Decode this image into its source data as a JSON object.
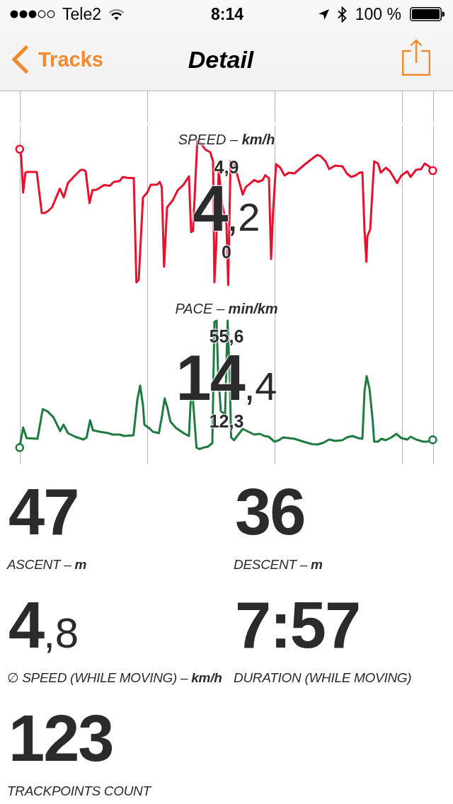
{
  "status_bar": {
    "carrier": "Tele2",
    "time": "8:14",
    "battery": "100 %"
  },
  "nav_bar": {
    "back": "Tracks",
    "title": "Detail"
  },
  "charts": [
    {
      "kind": "speed",
      "title": "SPEED – **km/h**",
      "color": "#e8112d",
      "max": "4,9",
      "average": {
        "whole": "4",
        "fraction": ",2"
      },
      "min": "0"
    },
    {
      "kind": "pace",
      "title": "PACE – **min/km**",
      "color": "#1e7b3f",
      "max": "55,6",
      "average": {
        "whole": "14",
        "fraction": ",4"
      },
      "min": "12,3"
    }
  ],
  "stats": [
    {
      "value": {
        "whole": "47"
      },
      "label": "ASCENT – **m**"
    },
    {
      "value": {
        "whole": "36"
      },
      "label": "DESCENT – **m**"
    },
    {
      "value": {
        "whole": "4",
        "fraction": ",8"
      },
      "label": "∅ SPEED (WHILE MOVING) – **km/h**"
    },
    {
      "value": {
        "whole": "7:57"
      },
      "label": "DURATION (WHILE MOVING)"
    },
    {
      "value": {
        "whole": "123"
      },
      "label": "TRACKPOINTS COUNT"
    }
  ]
}
